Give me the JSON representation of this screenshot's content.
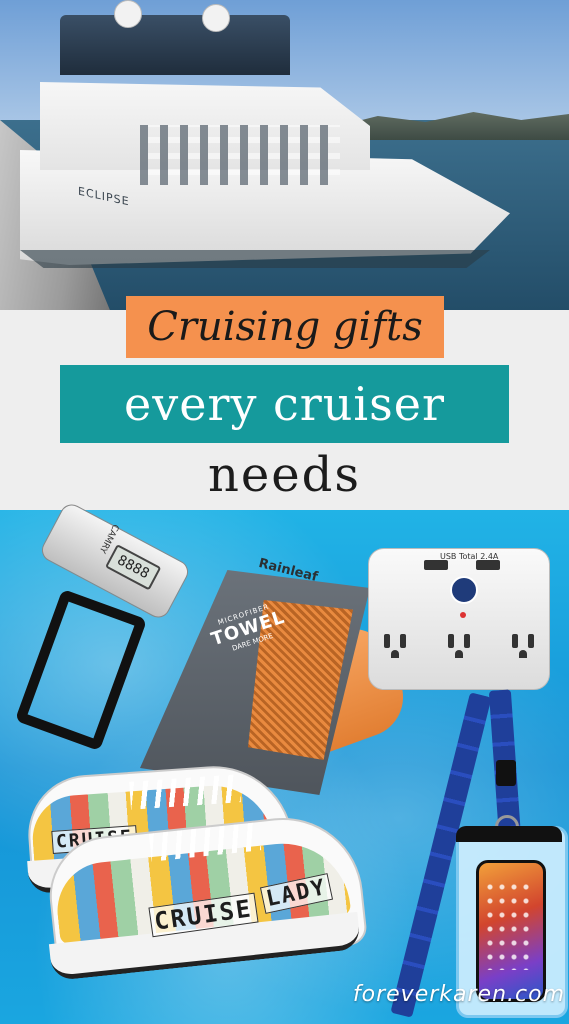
{
  "title": {
    "line1": "Cruising gifts",
    "line2": "every cruiser",
    "line3": "needs"
  },
  "ship": {
    "name": "ECLIPSE"
  },
  "products": {
    "scale": {
      "brand": "CAMRY",
      "display": "8888"
    },
    "towel": {
      "brand": "Rainleaf",
      "line1": "MICROFIBER",
      "line2": "TOWEL",
      "line3": "DARE MORE"
    },
    "adapter": {
      "usb_label": "USB Total 2.4A"
    },
    "sneakers": {
      "plate1": "CRUISE",
      "plate2": "CRUISE",
      "plate3": "LADY"
    }
  },
  "footer": {
    "site": "foreverkaren.com"
  },
  "colors": {
    "orange": "#f5914e",
    "teal": "#159a9c",
    "water": "#1aa6e0"
  }
}
